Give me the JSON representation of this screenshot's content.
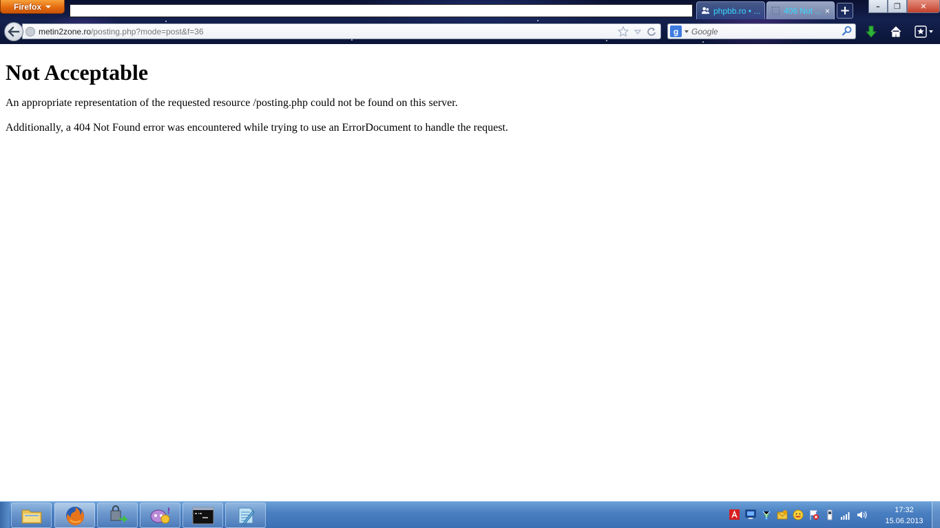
{
  "browser": {
    "app_button_label": "Firefox",
    "tabs": [
      {
        "label": "phpbb.ro • ...",
        "close": "×",
        "active": false
      },
      {
        "label": "406 Not ...",
        "close": "×",
        "active": true
      }
    ],
    "new_tab_label": "+",
    "window_controls": {
      "minimize": "–",
      "maximize": "❐",
      "close": "✕"
    },
    "url": {
      "host": "metin2zone.ro",
      "path": "/posting.php?mode=post&f=36"
    },
    "search": {
      "engine_logo": "g",
      "placeholder": "Google"
    },
    "icons": [
      "back-arrow-icon",
      "site-identity-icon",
      "bookmark-star-icon",
      "history-dropdown-icon",
      "reload-icon",
      "search-magnifier-icon",
      "download-arrow-icon",
      "home-icon",
      "bookmarks-menu-icon"
    ]
  },
  "page": {
    "title": "Not Acceptable",
    "paragraph1": "An appropriate representation of the requested resource /posting.php could not be found on this server.",
    "paragraph2": "Additionally, a 404 Not Found error was encountered while trying to use an ErrorDocument to handle the request."
  },
  "taskbar": {
    "apps": [
      "file-explorer-icon",
      "firefox-icon",
      "network-security-icon",
      "yahoo-messenger-icon",
      "command-prompt-icon",
      "notepad-icon"
    ],
    "active_app": "firefox-icon",
    "tray_icons": [
      "adobe-icon",
      "display-icon",
      "network-share-icon",
      "messenger-tray-icon",
      "emoticon-icon",
      "action-center-icon",
      "usb-device-icon",
      "signal-icon",
      "volume-icon"
    ],
    "clock": {
      "time": "17:32",
      "date": "15.06.2013"
    }
  },
  "colors": {
    "firefox_orange": "#e46b0e",
    "tab_text": "#39d6ff",
    "taskbar_blue": "#4a80c2"
  }
}
